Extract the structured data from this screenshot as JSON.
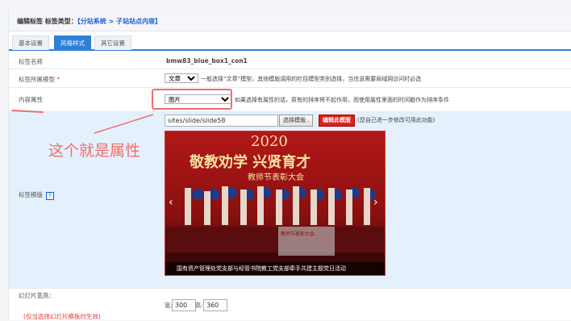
{
  "header": {
    "title_prefix": "编辑标签 标签类型：",
    "path": "【分站系统 > 子站站点内容】"
  },
  "tabs": [
    {
      "label": "基本设置"
    },
    {
      "label": "风格样式"
    },
    {
      "label": "其它设置"
    }
  ],
  "rows": {
    "name": {
      "label": "标签名称",
      "value": "bmw83_blue_box1_con1"
    },
    "model": {
      "label": "标签所属模型",
      "required": "*",
      "selected": "文章",
      "hint": "一般选择“文章”模型，其他模版调用的栏目模型类别选择，当信息需要局域网访问时必选"
    },
    "attr": {
      "label": "内容属性",
      "selected": "图片",
      "hint": "如果选择有属性的话，原有的排序将不起作用，而使用属性里面的时间戳作为排序条件"
    },
    "template": {
      "label": "标签模版",
      "help": "?",
      "path_value": "sites/slide/slide58",
      "choose_btn": "选择模版..",
      "edit_btn": "编辑此模版",
      "note": "(您自己进一步修改可用此功能)"
    },
    "slide_size": {
      "label": "幻灯片宽高：",
      "note": "(仅当选择幻灯片模板时生效)",
      "w_label": "宽:",
      "w": "300",
      "h_label": "高:",
      "h": "360"
    }
  },
  "annotation": {
    "text": "这个就是属性"
  },
  "slide": {
    "year": "2020",
    "headline": "敬教劝学   兴贤育才",
    "sub": "教师节表彰大会",
    "caption": "国有资产管理处党支部与经管书院教工党支部牵手共建主题党日活动",
    "screen": "教师节表彰大会"
  },
  "colors": {
    "accent": "#2f7fd6",
    "annotation": "#f06e6e",
    "red_button": "#e21d1d"
  }
}
